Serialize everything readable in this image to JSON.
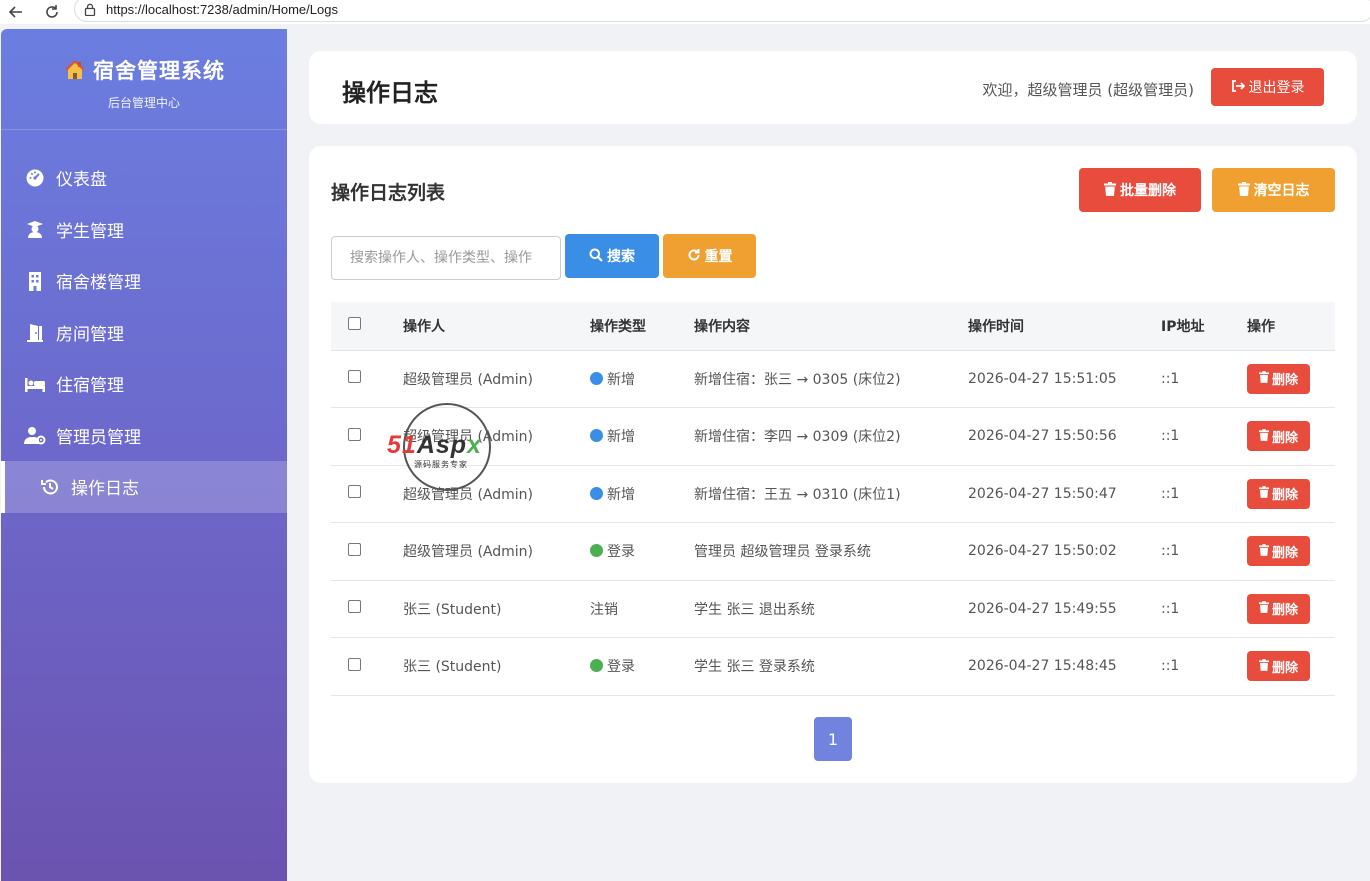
{
  "browser": {
    "url": "https://localhost:7238/admin/Home/Logs",
    "back_icon": "arrow-left-icon",
    "reload_icon": "reload-icon",
    "lock_icon": "lock-icon"
  },
  "sidebar": {
    "brand_title": "宿舍管理系统",
    "brand_subtitle": "后台管理中心",
    "brand_icon": "house-icon",
    "items": [
      {
        "label": "仪表盘",
        "icon": "dashboard-icon"
      },
      {
        "label": "学生管理",
        "icon": "graduation-icon"
      },
      {
        "label": "宿舍楼管理",
        "icon": "building-icon"
      },
      {
        "label": "房间管理",
        "icon": "door-icon"
      },
      {
        "label": "住宿管理",
        "icon": "bed-icon"
      },
      {
        "label": "管理员管理",
        "icon": "user-cog-icon"
      },
      {
        "label": "操作日志",
        "icon": "history-icon",
        "active": true
      }
    ]
  },
  "header": {
    "page_title": "操作日志",
    "welcome": "欢迎，超级管理员 (超级管理员)",
    "logout_label": "退出登录"
  },
  "list": {
    "title": "操作日志列表",
    "batch_delete_label": "批量删除",
    "clear_label": "清空日志",
    "search_placeholder": "搜索操作人、操作类型、操作",
    "search_label": "搜索",
    "reset_label": "重置",
    "columns": [
      "操作人",
      "操作类型",
      "操作内容",
      "操作时间",
      "IP地址",
      "操作"
    ],
    "delete_label": "删除",
    "rows": [
      {
        "operator": "超级管理员 (Admin)",
        "type": "新增",
        "dot": "#3a8ee6",
        "content": "新增住宿：张三 → 0305 (床位2)",
        "time": "2026-04-27 15:51:05",
        "ip": "::1"
      },
      {
        "operator": "超级管理员 (Admin)",
        "type": "新增",
        "dot": "#3a8ee6",
        "content": "新增住宿：李四 → 0309 (床位2)",
        "time": "2026-04-27 15:50:56",
        "ip": "::1"
      },
      {
        "operator": "超级管理员 (Admin)",
        "type": "新增",
        "dot": "#3a8ee6",
        "content": "新增住宿：王五 → 0310 (床位1)",
        "time": "2026-04-27 15:50:47",
        "ip": "::1"
      },
      {
        "operator": "超级管理员 (Admin)",
        "type": "登录",
        "dot": "#4caf50",
        "content": "管理员 超级管理员 登录系统",
        "time": "2026-04-27 15:50:02",
        "ip": "::1"
      },
      {
        "operator": "张三 (Student)",
        "type": "注销",
        "dot": "",
        "content": "学生 张三 退出系统",
        "time": "2026-04-27 15:49:55",
        "ip": "::1"
      },
      {
        "operator": "张三 (Student)",
        "type": "登录",
        "dot": "#4caf50",
        "content": "学生 张三 登录系统",
        "time": "2026-04-27 15:48:45",
        "ip": "::1"
      }
    ],
    "current_page": "1"
  },
  "watermark": {
    "logo_51": "51",
    "logo_asp": "Asp",
    "logo_x": "x",
    "tagline": "源码服务专家"
  }
}
